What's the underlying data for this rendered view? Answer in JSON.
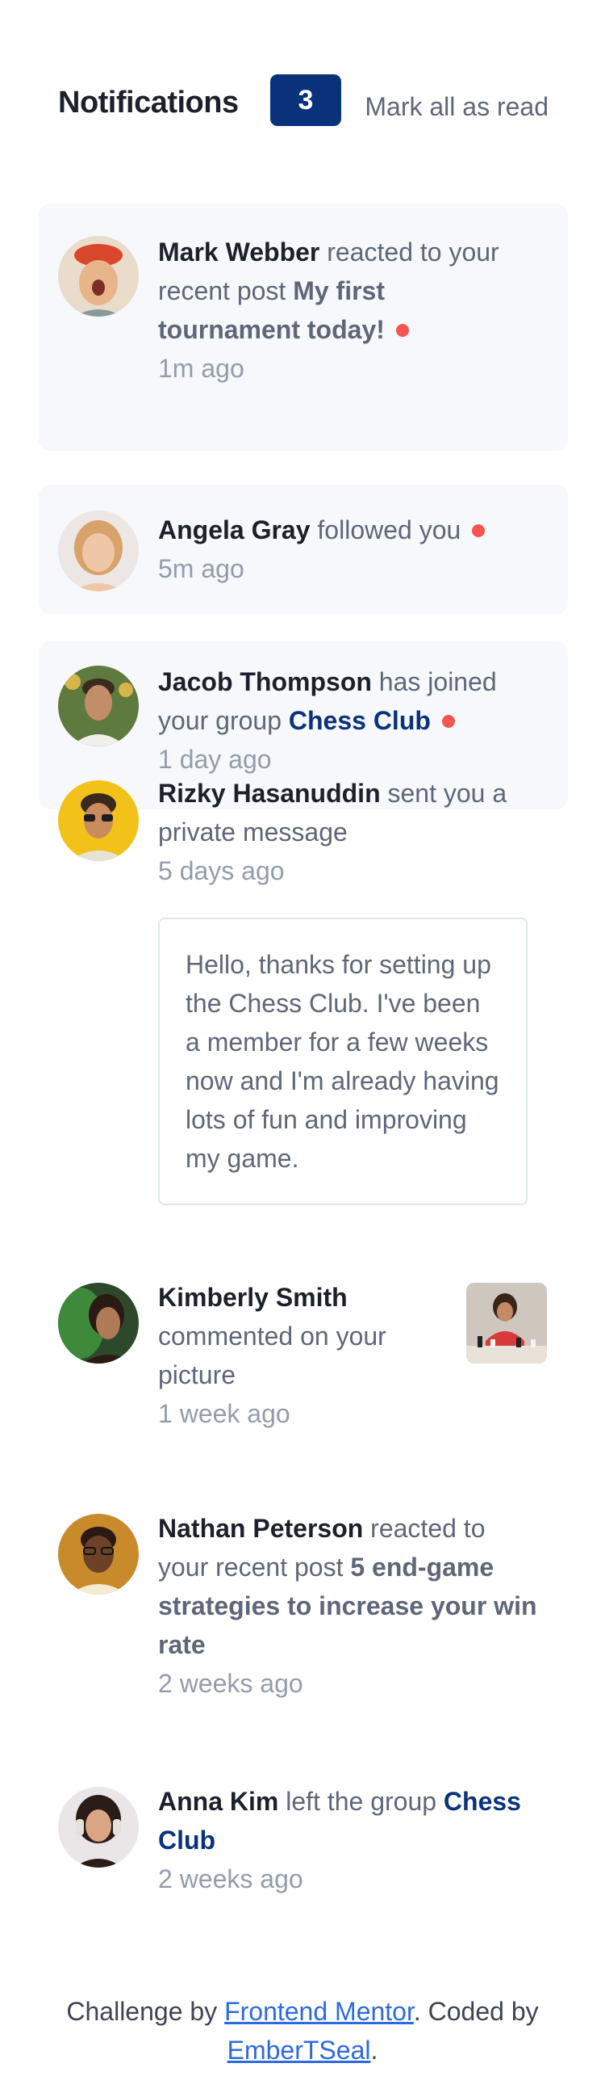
{
  "header": {
    "title": "Notifications",
    "count": "3",
    "mark_all": "Mark all as read"
  },
  "notifications": [
    {
      "actor": "Mark Webber",
      "action": "reacted to your recent post",
      "target": "My first tournament today!",
      "time": "1m ago",
      "unread": true,
      "avatar_icon": "avatar-mark-webber"
    },
    {
      "actor": "Angela Gray",
      "action": "followed you",
      "time": "5m ago",
      "unread": true,
      "avatar_icon": "avatar-angela-gray"
    },
    {
      "actor": "Jacob Thompson",
      "action": "has joined your group",
      "target": "Chess Club",
      "time": "1 day ago",
      "unread": true,
      "avatar_icon": "avatar-jacob-thompson"
    },
    {
      "actor": "Rizky Hasanuddin",
      "action": "sent you a private message",
      "time": "5 days ago",
      "unread": false,
      "message": "Hello, thanks for setting up the Chess Club. I've been a member for a few weeks now and I'm already having lots of fun and improving my game.",
      "avatar_icon": "avatar-rizky-hasanuddin"
    },
    {
      "actor": "Kimberly Smith",
      "action": "commented on your picture",
      "time": "1 week ago",
      "unread": false,
      "avatar_icon": "avatar-kimberly-smith"
    },
    {
      "actor": "Nathan Peterson",
      "action": "reacted to your recent post",
      "target": "5 end-game strategies to increase your win rate",
      "time": "2 weeks ago",
      "unread": false,
      "avatar_icon": "avatar-nathan-peterson"
    },
    {
      "actor": "Anna Kim",
      "action": "left the group",
      "target": "Chess Club",
      "time": "2 weeks ago",
      "unread": false,
      "avatar_icon": "avatar-anna-kim"
    }
  ],
  "footer": {
    "prefix": "Challenge by",
    "link1": "Frontend Mentor",
    "middle": ". Coded by",
    "link2": "EmberTSeal",
    "suffix": "."
  },
  "colors": {
    "primary_blue": "#0a327b",
    "unread_bg": "#f6f8fc",
    "red_dot": "#f65552",
    "dark_text": "#1c202b",
    "grey_text": "#5e6778",
    "light_grey": "#939cad"
  }
}
